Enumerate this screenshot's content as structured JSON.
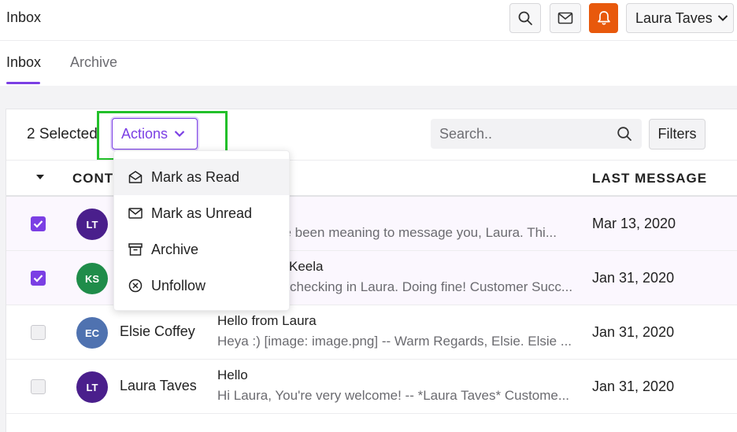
{
  "header": {
    "title": "Inbox",
    "user_name": "Laura Taves",
    "accent_color": "#7b3fe4",
    "bell_color": "#e8590c"
  },
  "tabs": [
    {
      "label": "Inbox",
      "active": true
    },
    {
      "label": "Archive",
      "active": false
    }
  ],
  "toolbar": {
    "selected_label": "2 Selected",
    "actions_label": "Actions",
    "search_placeholder": "Search..",
    "filters_label": "Filters"
  },
  "table": {
    "columns": [
      "CONTACT",
      "LAST MESSAGE"
    ],
    "column_contact_visible": "CONT",
    "rows": [
      {
        "initials": "LT",
        "avatar_color": "#4a1f8c",
        "name": "",
        "subject": "",
        "preview": "I've been meaning to message you, Laura. Thi...",
        "date": "Mar 13, 2020",
        "checked": true
      },
      {
        "initials": "KS",
        "avatar_color": "#1f8c4a",
        "name": "",
        "subject": "Keela",
        "preview": "checking in Laura. Doing fine! Customer Succ...",
        "date": "Jan 31, 2020",
        "checked": true
      },
      {
        "initials": "EC",
        "avatar_color": "#4f72b0",
        "name": "Elsie Coffey",
        "subject": "Hello from Laura",
        "preview": "Heya :) [image: image.png] -- Warm Regards, Elsie. Elsie ...",
        "date": "Jan 31, 2020",
        "checked": false
      },
      {
        "initials": "LT",
        "avatar_color": "#4a1f8c",
        "name": "Laura Taves",
        "subject": "Hello",
        "preview": "Hi Laura, You're very welcome! -- *Laura Taves* Custome...",
        "date": "Jan 31, 2020",
        "checked": false
      }
    ]
  },
  "actions_menu": {
    "items": [
      {
        "label": "Mark as Read",
        "icon": "envelope-open-icon"
      },
      {
        "label": "Mark as Unread",
        "icon": "envelope-icon"
      },
      {
        "label": "Archive",
        "icon": "archive-box-icon"
      },
      {
        "label": "Unfollow",
        "icon": "x-circle-icon"
      }
    ]
  }
}
